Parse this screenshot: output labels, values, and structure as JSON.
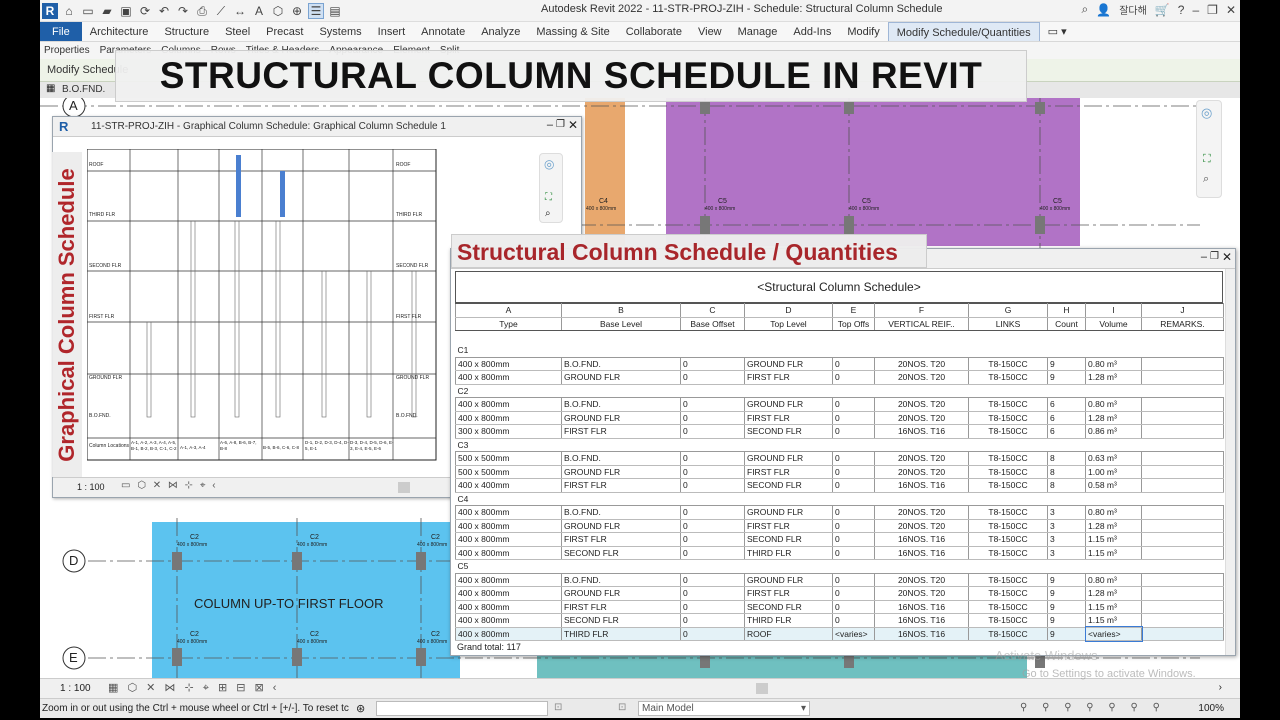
{
  "app": {
    "title": "Autodesk Revit 2022 - 11-STR-PROJ-ZIH - Schedule: Structural Column Schedule",
    "user_label": "잘다해",
    "logo_letter": "R"
  },
  "ribbon": {
    "tabs": [
      "File",
      "Architecture",
      "Structure",
      "Steel",
      "Precast",
      "Systems",
      "Insert",
      "Annotate",
      "Analyze",
      "Massing & Site",
      "Collaborate",
      "View",
      "Manage",
      "Add-Ins",
      "Modify",
      "Modify Schedule/Quantities"
    ],
    "active_tab": "Modify Schedule/Quantities",
    "panel_items": [
      "Properties",
      "Parameters",
      "Columns",
      "Rows",
      "Titles & Headers",
      "Appearance",
      "Element",
      "Split"
    ],
    "context_label": "Modify Schedule"
  },
  "banner": {
    "text": "STRUCTURAL COLUMN SCHEDULE IN REVIT"
  },
  "view_tab": {
    "label": "B.O.FND."
  },
  "plan": {
    "grid_labels": [
      "A",
      "D",
      "E"
    ],
    "upper_columns": [
      {
        "name": "C4",
        "size": "400 x 800mm"
      },
      {
        "name": "C5",
        "size": "400 x 800mm"
      },
      {
        "name": "C5",
        "size": "400 x 800mm"
      },
      {
        "name": "C5",
        "size": "400 x 800mm"
      }
    ],
    "lower_columns": [
      {
        "name": "C2",
        "size": "400 x 800mm"
      },
      {
        "name": "C2",
        "size": "400 x 800mm"
      },
      {
        "name": "C2",
        "size": "400 x 800mm"
      },
      {
        "name": "C2",
        "size": "400 x 800mm"
      },
      {
        "name": "C2",
        "size": "400 x 800mm"
      },
      {
        "name": "C2",
        "size": "400 x 800mm"
      }
    ],
    "region_label": "COLUMN UP-TO FIRST FLOOR",
    "colors": {
      "orange": "#e8a86e",
      "purple": "#b173c6",
      "blue": "#5cc3ef",
      "teal": "#6fc0c0"
    }
  },
  "graphical_window": {
    "title": "11-STR-PROJ-ZIH - Graphical Column Schedule: Graphical Column Schedule 1",
    "scale": "1 : 100",
    "vertical_label": "Graphical Column Schedule",
    "level_labels_left": [
      "ROOF",
      "THIRD FLR",
      "SECOND FLR",
      "FIRST FLR",
      "GROUND FLR",
      "B.O.FND.",
      "Column Locations"
    ],
    "level_labels_right": [
      "ROOF",
      "THIRD FLR",
      "SECOND FLR",
      "FIRST FLR",
      "GROUND FLR",
      "B.O.FND."
    ],
    "location_labels": [
      "A-1, A-2, A-3, A-4, A-5, B-1, B-2, B-3, C-1, C-2",
      "A-1, A-3, A-4",
      "A-6, A-8, B-6, B-7, B-8",
      "B-5, B-6, C-6, C-8",
      "D-1, D-2, D-3, D-4, D-5, E-1",
      "D-3, D-4, D-5, D-6, E-3, E-4, E-5, E-6"
    ]
  },
  "schedule": {
    "banner": "Structural Column Schedule / Quantities",
    "title": "<Structural Column Schedule>",
    "letters": [
      "A",
      "B",
      "C",
      "D",
      "E",
      "F",
      "G",
      "H",
      "I",
      "J"
    ],
    "headers": [
      "Type",
      "Base Level",
      "Base Offset",
      "Top Level",
      "Top Offs",
      "VERTICAL REIF..",
      "LINKS",
      "Count",
      "Volume",
      "REMARKS."
    ],
    "groups": [
      {
        "name": "C1",
        "rows": [
          [
            "400 x 800mm",
            "B.O.FND.",
            "0",
            "GROUND FLR",
            "0",
            "20NOS. T20",
            "T8-150CC",
            "9",
            "0.80 m³",
            ""
          ],
          [
            "400 x 800mm",
            "GROUND FLR",
            "0",
            "FIRST FLR",
            "0",
            "20NOS. T20",
            "T8-150CC",
            "9",
            "1.28 m³",
            ""
          ]
        ]
      },
      {
        "name": "C2",
        "rows": [
          [
            "400 x 800mm",
            "B.O.FND.",
            "0",
            "GROUND FLR",
            "0",
            "20NOS. T20",
            "T8-150CC",
            "6",
            "0.80 m³",
            ""
          ],
          [
            "400 x 800mm",
            "GROUND FLR",
            "0",
            "FIRST FLR",
            "0",
            "20NOS. T20",
            "T8-150CC",
            "6",
            "1.28 m³",
            ""
          ],
          [
            "300 x 800mm",
            "FIRST FLR",
            "0",
            "SECOND FLR",
            "0",
            "16NOS. T16",
            "T8-150CC",
            "6",
            "0.86 m³",
            ""
          ]
        ]
      },
      {
        "name": "C3",
        "rows": [
          [
            "500 x 500mm",
            "B.O.FND.",
            "0",
            "GROUND FLR",
            "0",
            "20NOS. T20",
            "T8-150CC",
            "8",
            "0.63 m³",
            ""
          ],
          [
            "500 x 500mm",
            "GROUND FLR",
            "0",
            "FIRST FLR",
            "0",
            "20NOS. T20",
            "T8-150CC",
            "8",
            "1.00 m³",
            ""
          ],
          [
            "400 x 400mm",
            "FIRST FLR",
            "0",
            "SECOND FLR",
            "0",
            "16NOS. T16",
            "T8-150CC",
            "8",
            "0.58 m³",
            ""
          ]
        ]
      },
      {
        "name": "C4",
        "rows": [
          [
            "400 x 800mm",
            "B.O.FND.",
            "0",
            "GROUND FLR",
            "0",
            "20NOS. T20",
            "T8-150CC",
            "3",
            "0.80 m³",
            ""
          ],
          [
            "400 x 800mm",
            "GROUND FLR",
            "0",
            "FIRST FLR",
            "0",
            "20NOS. T20",
            "T8-150CC",
            "3",
            "1.28 m³",
            ""
          ],
          [
            "400 x 800mm",
            "FIRST FLR",
            "0",
            "SECOND FLR",
            "0",
            "16NOS. T16",
            "T8-150CC",
            "3",
            "1.15 m³",
            ""
          ],
          [
            "400 x 800mm",
            "SECOND FLR",
            "0",
            "THIRD FLR",
            "0",
            "16NOS. T16",
            "T8-150CC",
            "3",
            "1.15 m³",
            ""
          ]
        ]
      },
      {
        "name": "C5",
        "rows": [
          [
            "400 x 800mm",
            "B.O.FND.",
            "0",
            "GROUND FLR",
            "0",
            "20NOS. T20",
            "T8-150CC",
            "9",
            "0.80 m³",
            ""
          ],
          [
            "400 x 800mm",
            "GROUND FLR",
            "0",
            "FIRST FLR",
            "0",
            "20NOS. T20",
            "T8-150CC",
            "9",
            "1.28 m³",
            ""
          ],
          [
            "400 x 800mm",
            "FIRST FLR",
            "0",
            "SECOND FLR",
            "0",
            "16NOS. T16",
            "T8-150CC",
            "9",
            "1.15 m³",
            ""
          ],
          [
            "400 x 800mm",
            "SECOND FLR",
            "0",
            "THIRD FLR",
            "0",
            "16NOS. T16",
            "T8-150CC",
            "9",
            "1.15 m³",
            ""
          ],
          [
            "400 x 800mm",
            "THIRD FLR",
            "0",
            "ROOF",
            "<varies>",
            "16NOS. T16",
            "T8-150CC",
            "9",
            "<varies>",
            ""
          ]
        ]
      }
    ],
    "grand_total": "Grand total: 117"
  },
  "view_control": {
    "scale": "1 : 100"
  },
  "status": {
    "hint": "Zoom in or out using the Ctrl + mouse wheel or Ctrl + [+/-]. To reset tc",
    "model": "Main Model",
    "zoom": "100%"
  },
  "watermark": {
    "line1": "Activate Windows",
    "line2": "Go to Settings to activate Windows."
  }
}
